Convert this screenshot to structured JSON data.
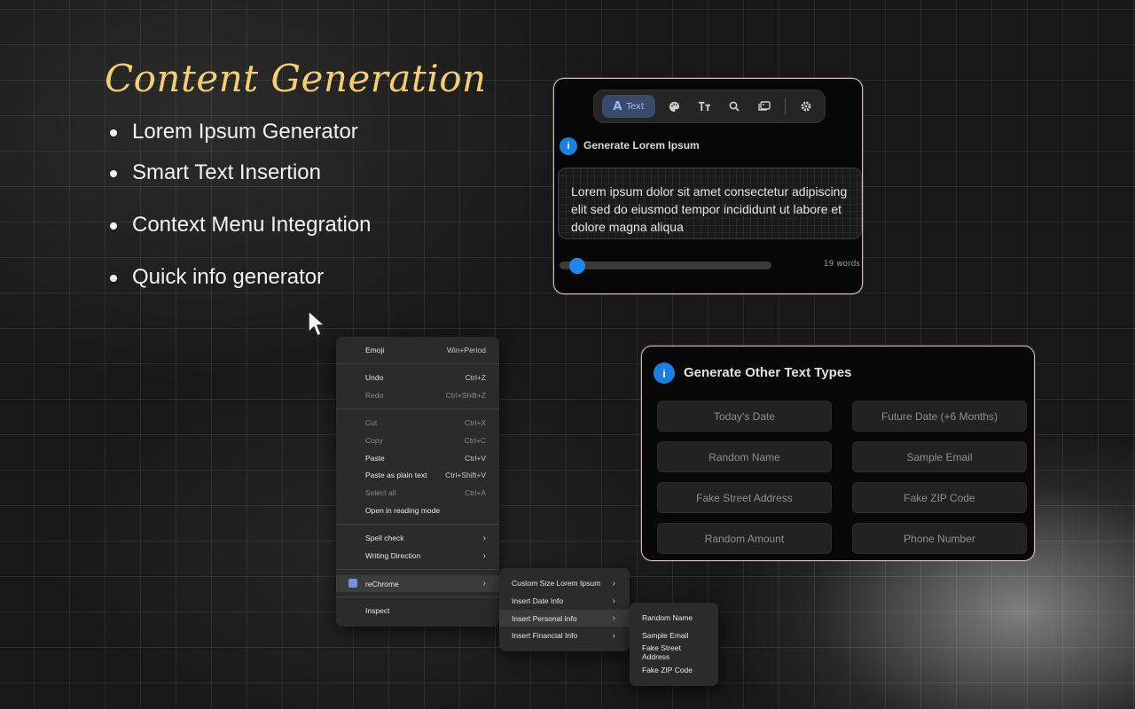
{
  "heading": "Content Generation",
  "features": [
    "Lorem Ipsum Generator",
    "Smart Text Insertion",
    "Context Menu Integration",
    "Quick info generator"
  ],
  "lorem_panel": {
    "toolbar": {
      "active_tab": "Text",
      "icons": [
        "palette-icon",
        "text-size-icon",
        "search-icon",
        "images-icon",
        "gear-icon"
      ]
    },
    "title": "Generate Lorem Ipsum",
    "text": "Lorem ipsum dolor sit amet consectetur adipiscing elit sed do eiusmod tempor incididunt ut labore et dolore magna aliqua",
    "word_count": "19 words",
    "slider_value": 0.05
  },
  "other_panel": {
    "title": "Generate Other Text Types",
    "buttons": [
      "Today's Date",
      "Future Date (+6 Months)",
      "Random Name",
      "Sample Email",
      "Fake Street Address",
      "Fake ZIP Code",
      "Random Amount",
      "Phone Number"
    ]
  },
  "context_menu": {
    "items": [
      {
        "label": "Emoji",
        "shortcut": "Win+Period"
      },
      {
        "label": "Undo",
        "shortcut": "Ctrl+Z"
      },
      {
        "label": "Redo",
        "shortcut": "Ctrl+Shift+Z"
      },
      {
        "label": "Cut",
        "shortcut": "Ctrl+X"
      },
      {
        "label": "Copy",
        "shortcut": "Ctrl+C"
      },
      {
        "label": "Paste",
        "shortcut": "Ctrl+V"
      },
      {
        "label": "Paste as plain text",
        "shortcut": "Ctrl+Shift+V"
      },
      {
        "label": "Select all",
        "shortcut": "Ctrl+A"
      },
      {
        "label": "Open in reading mode",
        "shortcut": ""
      },
      {
        "label": "Spell check",
        "shortcut": ""
      },
      {
        "label": "Writing Direction",
        "shortcut": ""
      },
      {
        "label": "reChrome",
        "shortcut": ""
      },
      {
        "label": "Inspect",
        "shortcut": ""
      }
    ],
    "submenu": [
      "Custom Size Lorem Ipsum",
      "Insert Date Info",
      "Insert Personal Info",
      "Insert Financial Info"
    ],
    "personal_submenu": [
      "Random Name",
      "Sample Email",
      "Fake Street Address",
      "Fake ZIP Code"
    ]
  },
  "colors": {
    "heading": "#f3cf70",
    "accent_blue": "#1f86ee",
    "panel_border": "#c9b6d2"
  }
}
